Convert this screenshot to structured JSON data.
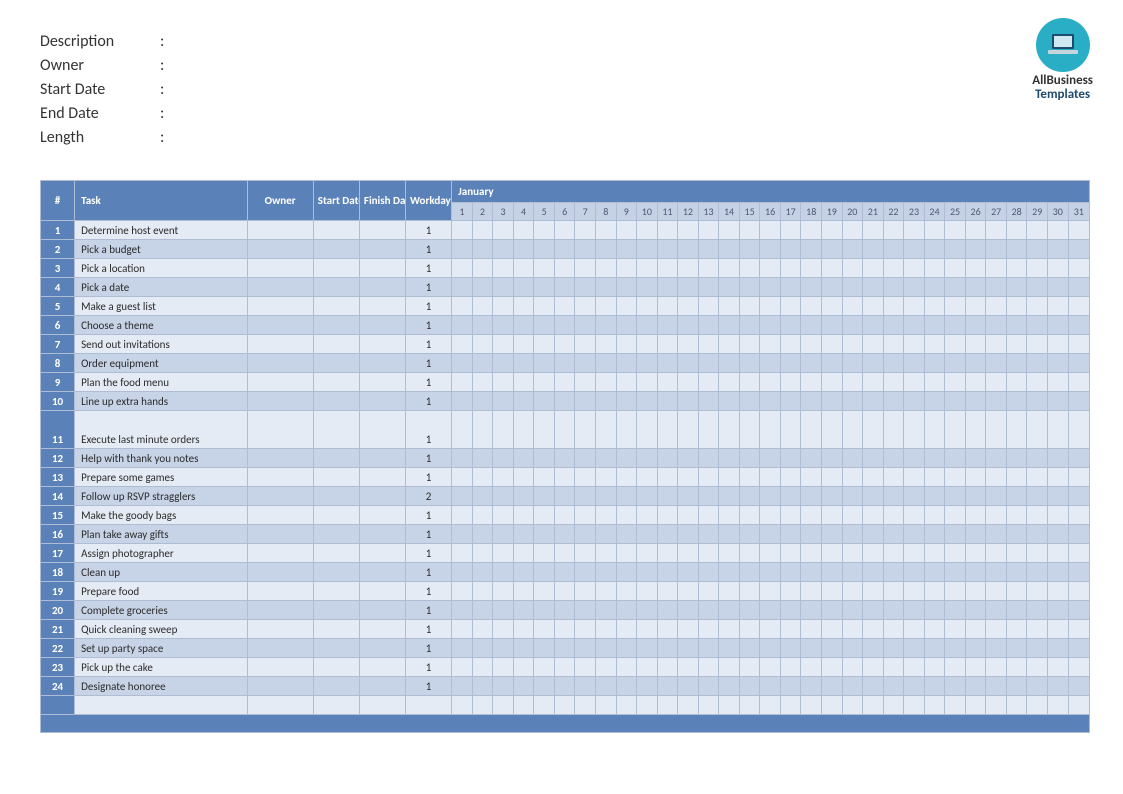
{
  "logo": {
    "line1": "AllBusiness",
    "line2": "Templates"
  },
  "meta": {
    "fields": [
      {
        "label": "Description",
        "value": ""
      },
      {
        "label": "Owner",
        "value": ""
      },
      {
        "label": "Start Date",
        "value": ""
      },
      {
        "label": "End Date",
        "value": ""
      },
      {
        "label": "Length",
        "value": ""
      }
    ]
  },
  "columns": {
    "num": "#",
    "task": "Task",
    "owner": "Owner",
    "start": "Start Date",
    "finish": "Finish Date",
    "work": "Workdays"
  },
  "month": "January",
  "days": [
    1,
    2,
    3,
    4,
    5,
    6,
    7,
    8,
    9,
    10,
    11,
    12,
    13,
    14,
    15,
    16,
    17,
    18,
    19,
    20,
    21,
    22,
    23,
    24,
    25,
    26,
    27,
    28,
    29,
    30,
    31
  ],
  "tasks": [
    {
      "n": 1,
      "task": "Determine host event",
      "owner": "",
      "start": "",
      "finish": "",
      "work": 1,
      "tall": false
    },
    {
      "n": 2,
      "task": "Pick a budget",
      "owner": "",
      "start": "",
      "finish": "",
      "work": 1,
      "tall": false
    },
    {
      "n": 3,
      "task": "Pick a location",
      "owner": "",
      "start": "",
      "finish": "",
      "work": 1,
      "tall": false
    },
    {
      "n": 4,
      "task": "Pick a date",
      "owner": "",
      "start": "",
      "finish": "",
      "work": 1,
      "tall": false
    },
    {
      "n": 5,
      "task": "Make a guest list",
      "owner": "",
      "start": "",
      "finish": "",
      "work": 1,
      "tall": false
    },
    {
      "n": 6,
      "task": "Choose a theme",
      "owner": "",
      "start": "",
      "finish": "",
      "work": 1,
      "tall": false
    },
    {
      "n": 7,
      "task": "Send out invitations",
      "owner": "",
      "start": "",
      "finish": "",
      "work": 1,
      "tall": false
    },
    {
      "n": 8,
      "task": "Order equipment",
      "owner": "",
      "start": "",
      "finish": "",
      "work": 1,
      "tall": false
    },
    {
      "n": 9,
      "task": "Plan the food menu",
      "owner": "",
      "start": "",
      "finish": "",
      "work": 1,
      "tall": false
    },
    {
      "n": 10,
      "task": "Line up extra hands",
      "owner": "",
      "start": "",
      "finish": "",
      "work": 1,
      "tall": false
    },
    {
      "n": 11,
      "task": "Execute last minute orders",
      "owner": "",
      "start": "",
      "finish": "",
      "work": 1,
      "tall": true
    },
    {
      "n": 12,
      "task": "Help with thank you notes",
      "owner": "",
      "start": "",
      "finish": "",
      "work": 1,
      "tall": false
    },
    {
      "n": 13,
      "task": "Prepare some games",
      "owner": "",
      "start": "",
      "finish": "",
      "work": 1,
      "tall": false
    },
    {
      "n": 14,
      "task": "Follow up RSVP stragglers",
      "owner": "",
      "start": "",
      "finish": "",
      "work": 2,
      "tall": false
    },
    {
      "n": 15,
      "task": "Make the goody bags",
      "owner": "",
      "start": "",
      "finish": "",
      "work": 1,
      "tall": false
    },
    {
      "n": 16,
      "task": "Plan take away gifts",
      "owner": "",
      "start": "",
      "finish": "",
      "work": 1,
      "tall": false
    },
    {
      "n": 17,
      "task": "Assign photographer",
      "owner": "",
      "start": "",
      "finish": "",
      "work": 1,
      "tall": false
    },
    {
      "n": 18,
      "task": "Clean up",
      "owner": "",
      "start": "",
      "finish": "",
      "work": 1,
      "tall": false
    },
    {
      "n": 19,
      "task": "Prepare food",
      "owner": "",
      "start": "",
      "finish": "",
      "work": 1,
      "tall": false
    },
    {
      "n": 20,
      "task": "Complete groceries",
      "owner": "",
      "start": "",
      "finish": "",
      "work": 1,
      "tall": false
    },
    {
      "n": 21,
      "task": "Quick cleaning sweep",
      "owner": "",
      "start": "",
      "finish": "",
      "work": 1,
      "tall": false
    },
    {
      "n": 22,
      "task": "Set up party space",
      "owner": "",
      "start": "",
      "finish": "",
      "work": 1,
      "tall": false
    },
    {
      "n": 23,
      "task": "Pick up the cake",
      "owner": "",
      "start": "",
      "finish": "",
      "work": 1,
      "tall": false
    },
    {
      "n": 24,
      "task": "Designate honoree",
      "owner": "",
      "start": "",
      "finish": "",
      "work": 1,
      "tall": false
    }
  ]
}
